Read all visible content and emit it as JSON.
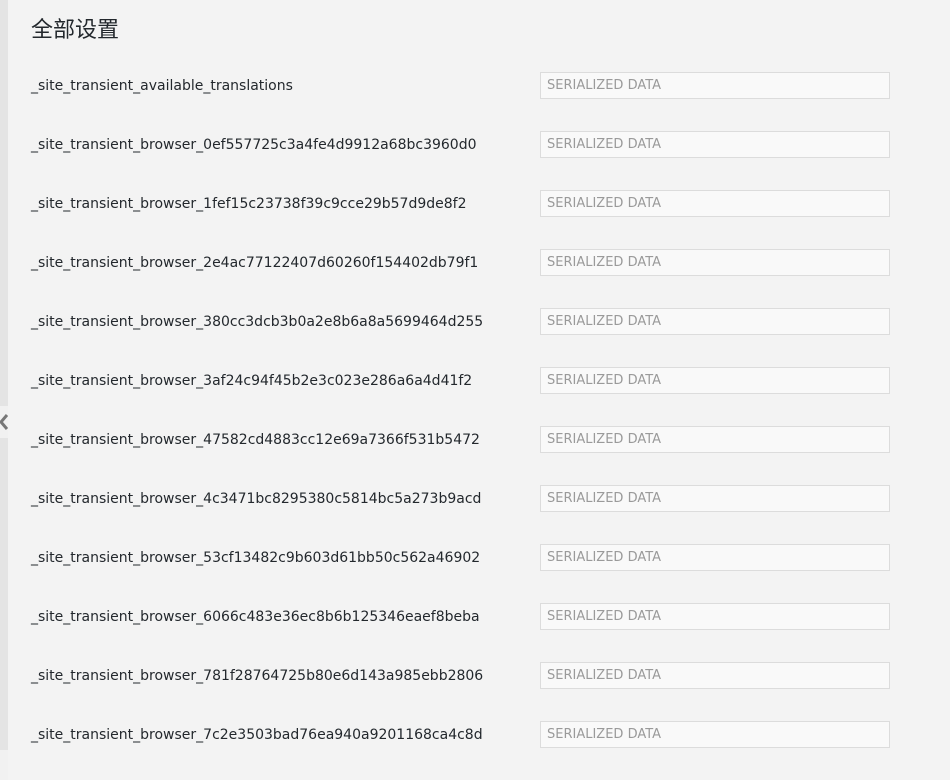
{
  "page": {
    "title": "全部设置"
  },
  "options": [
    {
      "name": "_site_transient_available_translations",
      "value": "SERIALIZED DATA"
    },
    {
      "name": "_site_transient_browser_0ef557725c3a4fe4d9912a68bc3960d0",
      "value": "SERIALIZED DATA"
    },
    {
      "name": "_site_transient_browser_1fef15c23738f39c9cce29b57d9de8f2",
      "value": "SERIALIZED DATA"
    },
    {
      "name": "_site_transient_browser_2e4ac77122407d60260f154402db79f1",
      "value": "SERIALIZED DATA"
    },
    {
      "name": "_site_transient_browser_380cc3dcb3b0a2e8b6a8a5699464d255",
      "value": "SERIALIZED DATA"
    },
    {
      "name": "_site_transient_browser_3af24c94f45b2e3c023e286a6a4d41f2",
      "value": "SERIALIZED DATA"
    },
    {
      "name": "_site_transient_browser_47582cd4883cc12e69a7366f531b5472",
      "value": "SERIALIZED DATA"
    },
    {
      "name": "_site_transient_browser_4c3471bc8295380c5814bc5a273b9acd",
      "value": "SERIALIZED DATA"
    },
    {
      "name": "_site_transient_browser_53cf13482c9b603d61bb50c562a46902",
      "value": "SERIALIZED DATA"
    },
    {
      "name": "_site_transient_browser_6066c483e36ec8b6b125346eaef8beba",
      "value": "SERIALIZED DATA"
    },
    {
      "name": "_site_transient_browser_781f28764725b80e6d143a985ebb2806",
      "value": "SERIALIZED DATA"
    },
    {
      "name": "_site_transient_browser_7c2e3503bad76ea940a9201168ca4c8d",
      "value": "SERIALIZED DATA"
    }
  ],
  "icons": {
    "collapse": "chevron-left-icon"
  },
  "colors": {
    "background": "#f3f3f3",
    "text": "#23282d",
    "input_border": "#dcdcdc",
    "input_text": "#9a9a9a"
  }
}
